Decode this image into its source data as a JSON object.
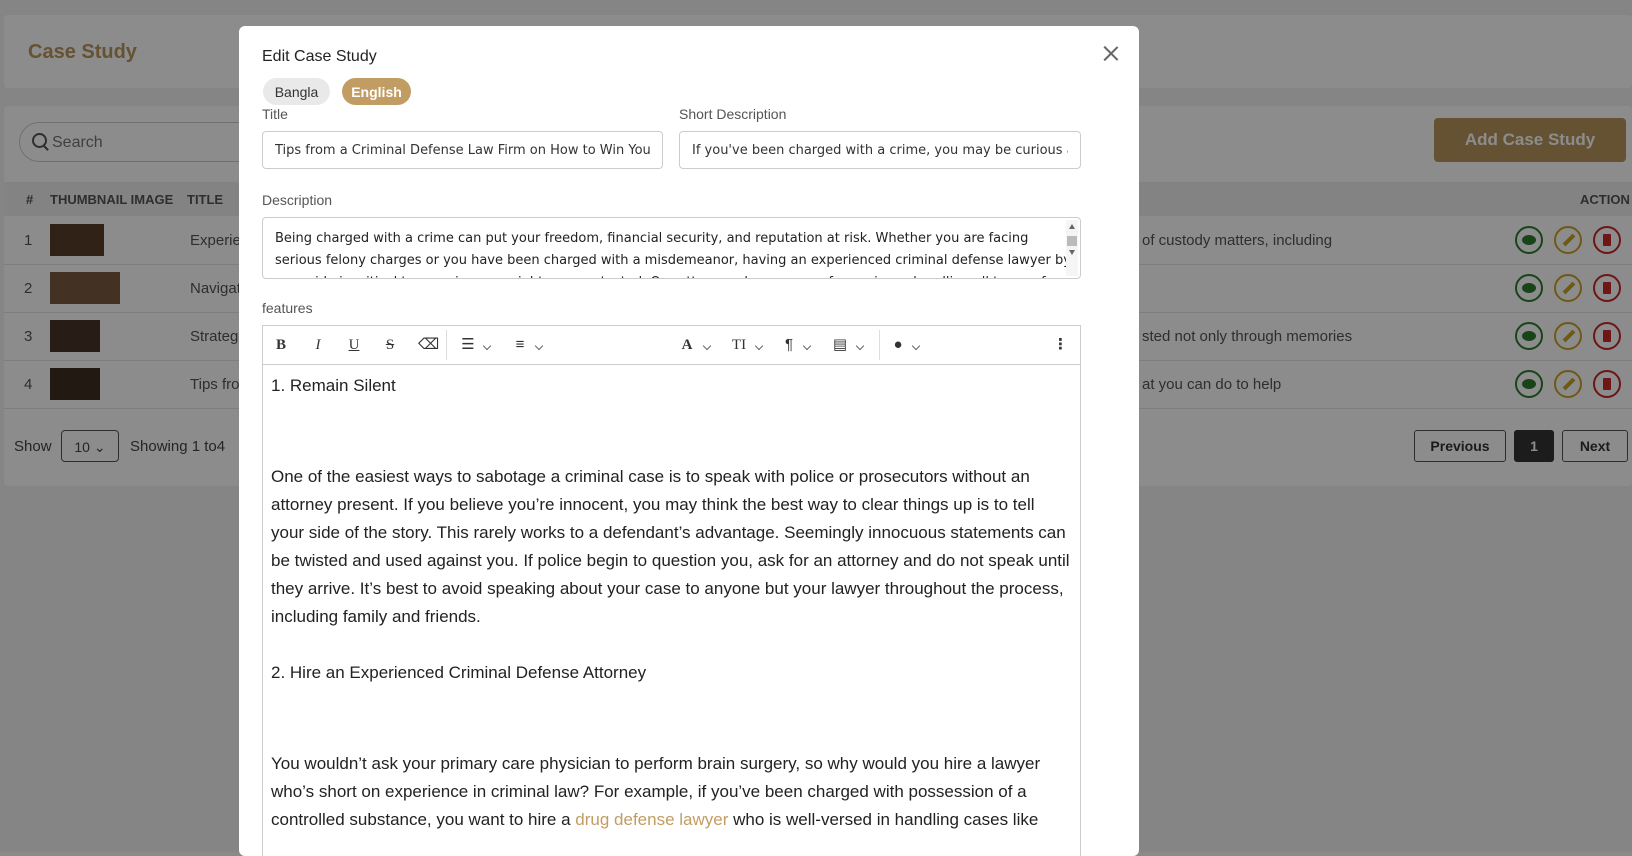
{
  "page": {
    "title": "Case Study",
    "search_placeholder": "Search",
    "add_button": "Add Case Study",
    "table_headers": {
      "num": "#",
      "thumbnail": "THUMBNAIL IMAGE",
      "title": "TITLE",
      "action": "ACTION"
    },
    "rows": [
      {
        "num": "1",
        "title": "Experie",
        "desc": "of custody matters, including"
      },
      {
        "num": "2",
        "title": "Navigat",
        "desc": ""
      },
      {
        "num": "3",
        "title": "Strateg",
        "desc": "sted not only through memories"
      },
      {
        "num": "4",
        "title": "Tips fro",
        "desc": "at you can do to help"
      }
    ],
    "show_label": "Show",
    "per_page": "10",
    "showing_text": "Showing 1  to4",
    "pagination": {
      "previous": "Previous",
      "current": "1",
      "next": "Next"
    }
  },
  "modal": {
    "title": "Edit Case Study",
    "tabs": {
      "bangla": "Bangla",
      "english": "English"
    },
    "title_label": "Title",
    "title_value": "Tips from a Criminal Defense Law Firm on How to Win Your Case",
    "short_label": "Short Description",
    "short_value": "If you've been charged with a crime, you may be curious about what you can do to help",
    "desc_label": "Description",
    "desc_value": "Being charged with a crime can put your freedom, financial security, and reputation at risk. Whether you are facing serious felony charges or you have been charged with a misdemeanor, having an experienced criminal defense lawyer by your side is critical to ensuring your rights are protected. Our attorneys have years of experience handling all types of criminal cases. Contact us today.",
    "features_label": "features",
    "toolbar_icons": [
      "bold-icon",
      "italic-icon",
      "underline-icon",
      "strikethrough-icon",
      "eraser-icon",
      "bullet-list-icon",
      "numbered-list-icon",
      "font-color-icon",
      "font-size-icon",
      "paragraph-icon",
      "align-icon",
      "highlight-icon",
      "more-icon"
    ],
    "content": {
      "h1": "1. Remain Silent",
      "p1": "One of the easiest ways to sabotage a criminal case is to speak with police or prosecutors without an attorney present. If you believe you’re innocent, you may think the best way to clear things up is to tell your side of the story. This rarely works to a defendant’s advantage. Seemingly innocuous statements can be twisted and used against you. If police begin to question you, ask for an attorney and do not speak until they arrive. It’s best to avoid speaking about your case to anyone but your lawyer throughout the process, including family and friends.",
      "h2": "2. Hire an Experienced Criminal Defense Attorney",
      "p2_a": "You wouldn’t ask your primary care physician to perform brain surgery, so why would you hire a lawyer who’s short on experience in criminal law? For example, if you’ve been charged with possession of a controlled substance, you want to hire a ",
      "p2_link": "drug defense lawyer",
      "p2_b": " who is well-versed in handling cases like"
    }
  },
  "colors": {
    "brand": "#b9955e",
    "view": "#2e7d32",
    "edit": "#c9a227",
    "delete": "#c62828"
  }
}
